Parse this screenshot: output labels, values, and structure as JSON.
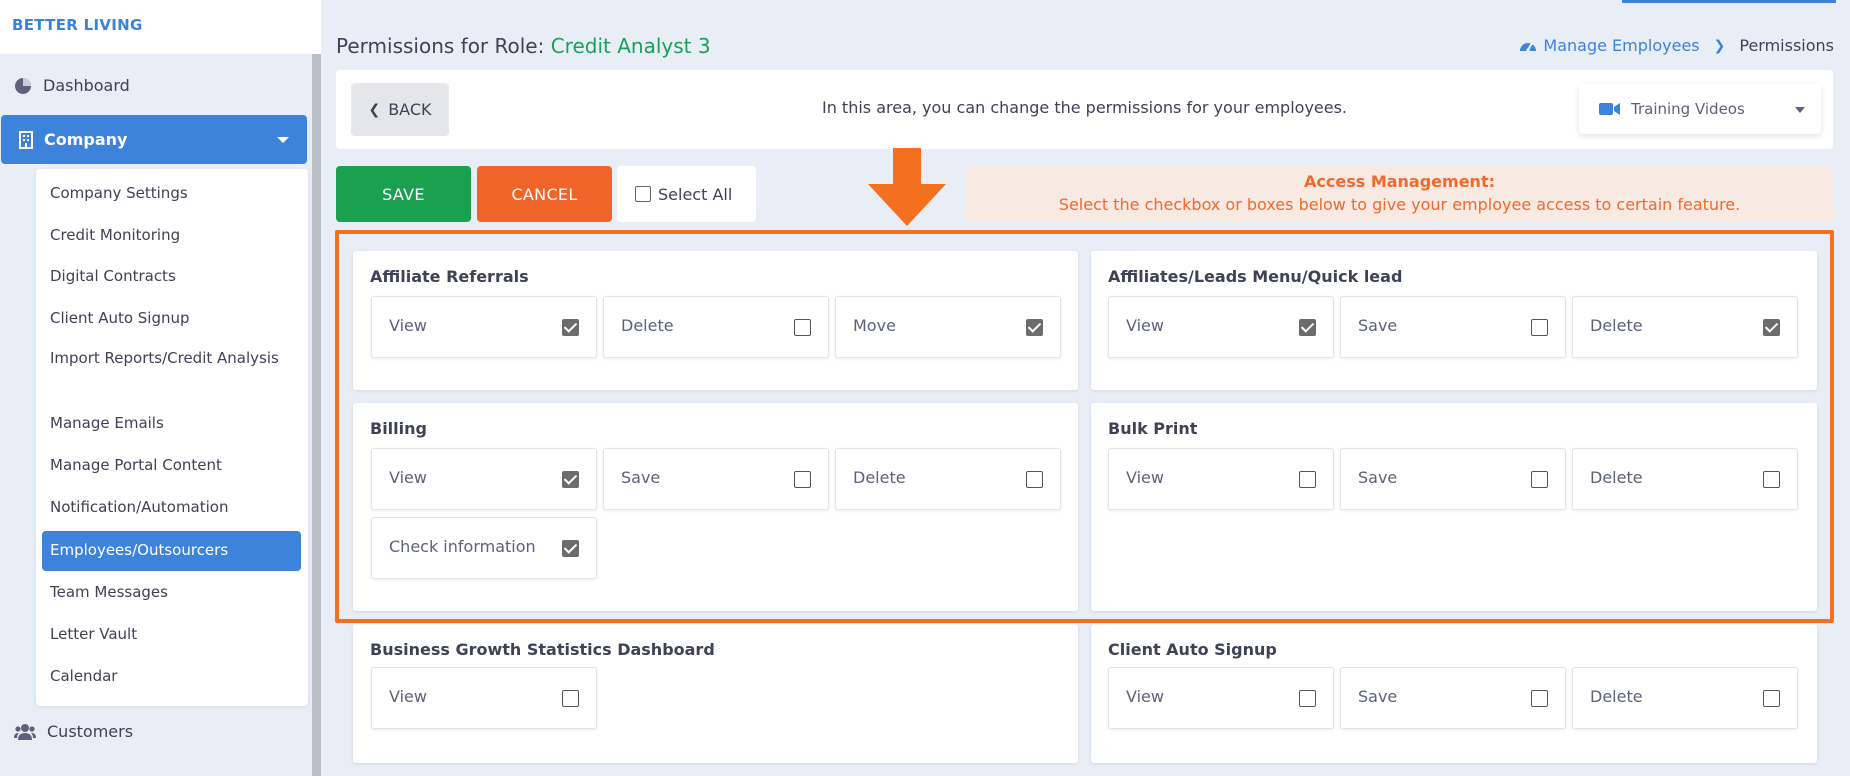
{
  "brand": "BETTER LIVING",
  "nav": {
    "dashboard": "Dashboard",
    "company": "Company",
    "customers": "Customers"
  },
  "submenu": [
    {
      "label": "Company Settings"
    },
    {
      "label": "Credit Monitoring"
    },
    {
      "label": "Digital Contracts"
    },
    {
      "label": "Client Auto Signup"
    },
    {
      "label": "Import Reports/Credit Analysis"
    },
    {
      "label": "Manage Emails"
    },
    {
      "label": "Manage Portal Content"
    },
    {
      "label": "Notification/Automation"
    },
    {
      "label": "Employees/Outsourcers"
    },
    {
      "label": "Team Messages"
    },
    {
      "label": "Letter Vault"
    },
    {
      "label": "Calendar"
    }
  ],
  "header": {
    "title_prefix": "Permissions for Role:",
    "role_name": "Credit Analyst 3",
    "breadcrumb_link": "Manage Employees",
    "breadcrumb_current": "Permissions"
  },
  "toolbar": {
    "back_label": "BACK",
    "message": "In this area, you can change the permissions for your employees.",
    "training_videos": "Training Videos"
  },
  "actions": {
    "save": "SAVE",
    "cancel": "CANCEL",
    "select_all": "Select All"
  },
  "access": {
    "heading": "Access Management:",
    "text": "Select the checkbox or boxes below to give your employee access to certain feature."
  },
  "colors": {
    "accent_blue": "#3d82db",
    "save_green": "#1aa04f",
    "cancel_orange": "#f0642a",
    "highlight_orange": "#f4701f",
    "role_green": "#1aa05a"
  },
  "cards": [
    {
      "title": "Affiliate Referrals",
      "perms": [
        {
          "label": "View",
          "checked": true
        },
        {
          "label": "Delete",
          "checked": false
        },
        {
          "label": "Move",
          "checked": true
        }
      ]
    },
    {
      "title": "Affiliates/Leads Menu/Quick lead",
      "perms": [
        {
          "label": "View",
          "checked": true
        },
        {
          "label": "Save",
          "checked": false
        },
        {
          "label": "Delete",
          "checked": true
        }
      ]
    },
    {
      "title": "Billing",
      "perms": [
        {
          "label": "View",
          "checked": true
        },
        {
          "label": "Save",
          "checked": false
        },
        {
          "label": "Delete",
          "checked": false
        },
        {
          "label": "Check information",
          "checked": true
        }
      ]
    },
    {
      "title": "Bulk Print",
      "perms": [
        {
          "label": "View",
          "checked": false
        },
        {
          "label": "Save",
          "checked": false
        },
        {
          "label": "Delete",
          "checked": false
        }
      ]
    },
    {
      "title": "Business Growth Statistics Dashboard",
      "perms": [
        {
          "label": "View",
          "checked": false
        }
      ]
    },
    {
      "title": "Client Auto Signup",
      "perms": [
        {
          "label": "View",
          "checked": false
        },
        {
          "label": "Save",
          "checked": false
        },
        {
          "label": "Delete",
          "checked": false
        }
      ]
    }
  ]
}
